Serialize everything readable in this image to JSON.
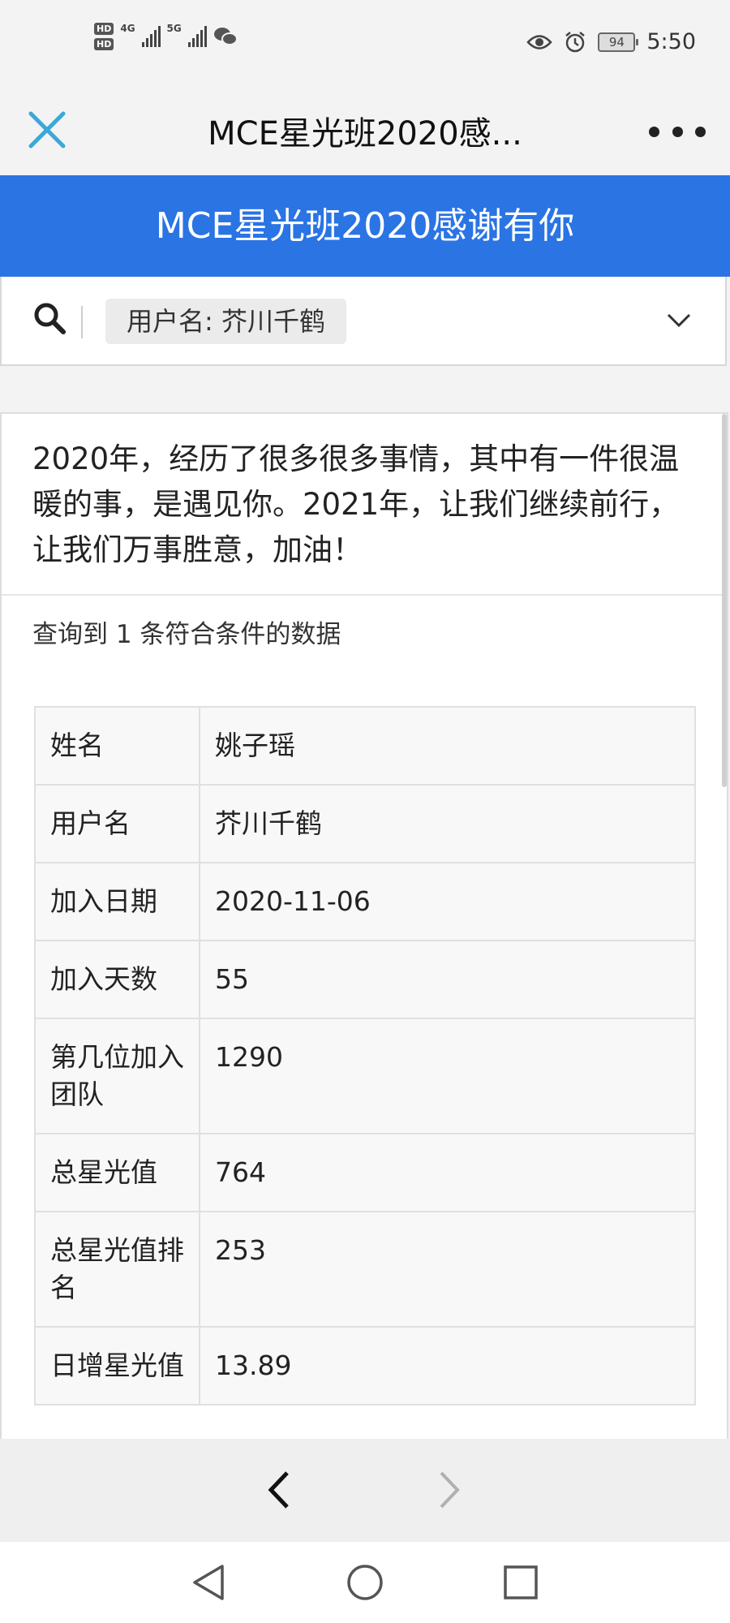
{
  "status_bar": {
    "network_left": "4G",
    "network_right": "5G",
    "hd1": "HD",
    "hd2": "HD",
    "battery": "94",
    "time": "5:50"
  },
  "titlebar": {
    "title": "MCE星光班2020感..."
  },
  "header": {
    "title": "MCE星光班2020感谢有你"
  },
  "search": {
    "chip_label": "用户名: 芥川千鹤"
  },
  "intro": "2020年，经历了很多很多事情，其中有一件很温暖的事，是遇见你。2021年，让我们继续前行，让我们万事胜意，加油！",
  "result_count": "查询到 1 条符合条件的数据",
  "table": [
    {
      "key": "姓名",
      "value": "姚子瑶"
    },
    {
      "key": "用户名",
      "value": "芥川千鹤"
    },
    {
      "key": "加入日期",
      "value": "2020-11-06"
    },
    {
      "key": "加入天数",
      "value": "55"
    },
    {
      "key": "第几位加入团队",
      "value": "1290"
    },
    {
      "key": "总星光值",
      "value": "764"
    },
    {
      "key": "总星光值排名",
      "value": "253"
    },
    {
      "key": "日增星光值",
      "value": "13.89"
    }
  ],
  "colors": {
    "header_blue": "#2a74e4",
    "close_icon": "#3aa8d8"
  }
}
